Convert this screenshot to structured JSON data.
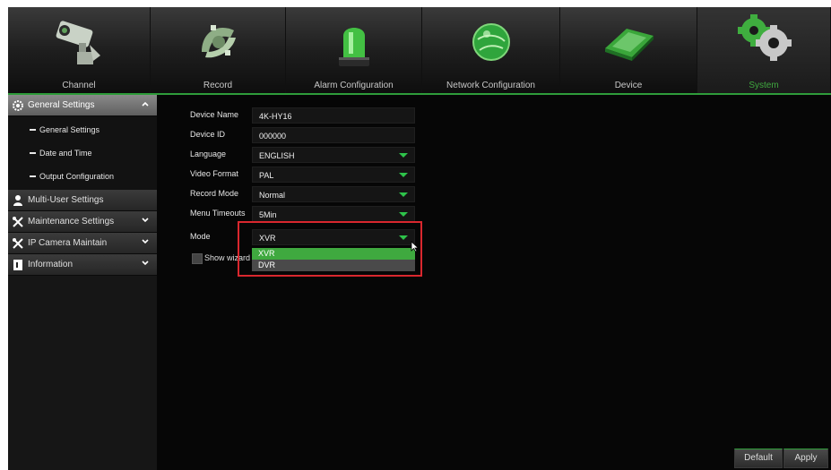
{
  "nav": {
    "tabs": [
      {
        "label": "Channel",
        "icon": "camera-icon"
      },
      {
        "label": "Record",
        "icon": "film-reel-icon"
      },
      {
        "label": "Alarm Configuration",
        "icon": "alarm-light-icon"
      },
      {
        "label": "Network Configuration",
        "icon": "globe-icon"
      },
      {
        "label": "Device",
        "icon": "hard-drive-icon"
      },
      {
        "label": "System",
        "icon": "gears-icon"
      }
    ],
    "active": "System"
  },
  "sidebar": {
    "general": {
      "label": "General Settings",
      "sub": [
        "General Settings",
        "Date and Time",
        "Output Configuration"
      ]
    },
    "multi_user": "Multi-User Settings",
    "maintenance": "Maintenance Settings",
    "ip_camera": "IP Camera Maintain",
    "information": "Information"
  },
  "form": {
    "device_name": {
      "label": "Device Name",
      "value": "4K-HY16"
    },
    "device_id": {
      "label": "Device ID",
      "value": "000000"
    },
    "language": {
      "label": "Language",
      "value": "ENGLISH"
    },
    "video_format": {
      "label": "Video Format",
      "value": "PAL"
    },
    "record_mode": {
      "label": "Record Mode",
      "value": "Normal"
    },
    "menu_timeouts": {
      "label": "Menu Timeouts",
      "value": "5Min"
    },
    "mode": {
      "label": "Mode",
      "value": "XVR",
      "options": [
        "XVR",
        "DVR"
      ]
    },
    "show_wizard": "Show wizard"
  },
  "buttons": {
    "default": "Default",
    "apply": "Apply"
  },
  "colors": {
    "accent": "#2e9c3a",
    "highlight": "#d9272e"
  }
}
